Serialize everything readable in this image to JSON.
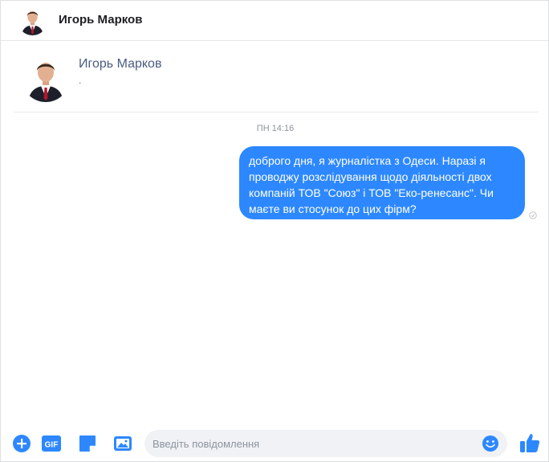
{
  "header": {
    "name": "Игорь Марков"
  },
  "intro": {
    "name": "Игорь Марков",
    "subtitle": "."
  },
  "thread": {
    "timestamp": "ПН 14:16",
    "messages": [
      {
        "text": "доброго дня, я журналістка з Одеси. Наразі я проводжу розслідування щодо діяльності двох компаній ТОВ \"Союз\" і ТОВ \"Еко-ренесанс\". Чи маєте ви стосунок до цих фірм?"
      }
    ]
  },
  "composer": {
    "placeholder": "Введіть повідомлення",
    "value": ""
  },
  "icons": {
    "add": "plus-circle-icon",
    "gif": "gif-icon",
    "sticker": "sticker-icon",
    "photo": "photo-icon",
    "emoji": "emoji-icon",
    "like": "thumbs-up-icon",
    "seen": "check-circle-icon"
  },
  "colors": {
    "accent": "#2d88ff",
    "bubble_text": "#ffffff",
    "name_link": "#4b5c82"
  }
}
